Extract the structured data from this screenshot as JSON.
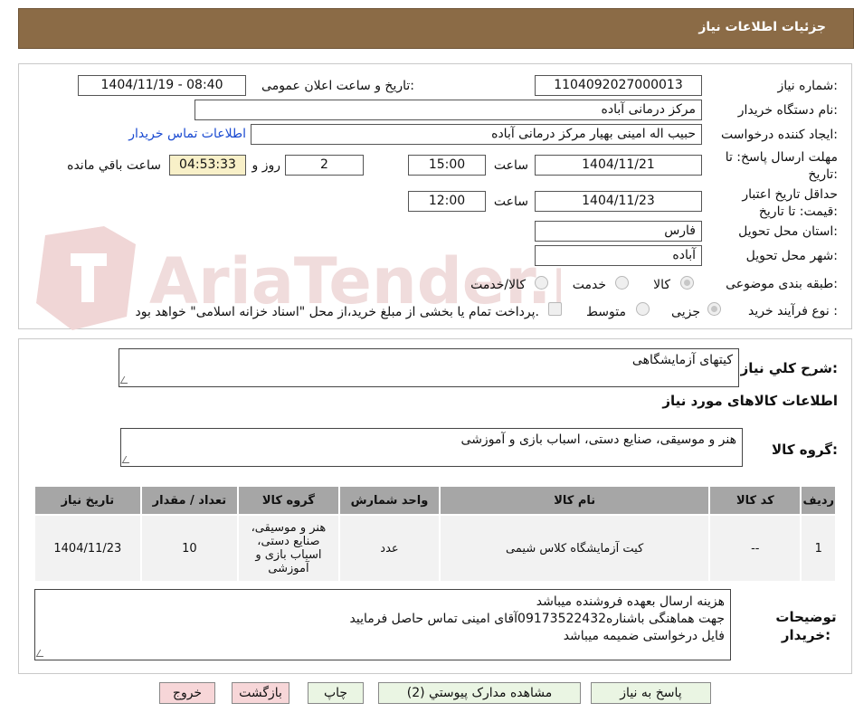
{
  "header": {
    "title": "جزئیات اطلاعات نیاز"
  },
  "form": {
    "need_number_label": "شماره نیاز:",
    "need_number": "1104092027000013",
    "announce_label": "تاریخ و ساعت اعلان عمومی:",
    "announce_value": "1404/11/19 - 08:40",
    "buyer_org_label": "نام دستگاه خریدار:",
    "buyer_org": "مرکز درمانی آباده",
    "creator_label": "ایجاد کننده درخواست:",
    "creator": "حبیب اله امینی بهیار مرکز درمانی آباده",
    "contact_link": "اطلاعات تماس خریدار",
    "deadline_label": "مهلت ارسال پاسخ: تا تاریخ:",
    "deadline_date": "1404/11/21",
    "time_label": "ساعت",
    "deadline_time": "15:00",
    "days_value": "2",
    "days_label": "روز و",
    "remaining_time": "04:53:33",
    "remaining_label": "ساعت باقي مانده",
    "validity_label": "حداقل تاریخ اعتبار قیمت: تا تاریخ:",
    "validity_date": "1404/11/23",
    "validity_time": "12:00",
    "province_label": "استان محل تحویل:",
    "province": "فارس",
    "city_label": "شهر محل تحویل:",
    "city": "آباده",
    "category_label": "طبقه بندی موضوعی:",
    "category_options": [
      "کالا",
      "خدمت",
      "کالا/خدمت"
    ],
    "process_label": "نوع فرآیند خرید :",
    "process_options": [
      "جزیی",
      "متوسط"
    ],
    "payment_note": "پرداخت تمام یا بخشی از مبلغ خرید،از محل \"اسناد خزانه اسلامی\" خواهد بود."
  },
  "watermark": {
    "text": "AriaTender.neT"
  },
  "details": {
    "summary_label": "شرح کلي نیاز:",
    "summary_value": "کیتهای آزمایشگاهی",
    "goods_section_title": "اطلاعات کالاهای مورد نیاز",
    "goods_group_label": "گروه کالا:",
    "goods_group_value": "هنر و موسیقی، صنایع دستی، اسباب بازی و آموزشی",
    "table": {
      "headers": [
        "ردیف",
        "کد کالا",
        "نام کالا",
        "واحد شمارش",
        "گروه کالا",
        "تعداد / مقدار",
        "تاریخ نیاز"
      ],
      "rows": [
        [
          "1",
          "--",
          "کیت آزمایشگاه کلاس شیمی",
          "عدد",
          "هنر و موسیقی، صنایع دستی، اسباب بازی و آموزشی",
          "10",
          "1404/11/23"
        ]
      ]
    },
    "buyer_notes_label": "توضیحات خریدار:",
    "buyer_notes": [
      "هزینه ارسال بعهده فروشنده میباشد",
      "جهت هماهنگی باشناره09173522432آقای امینی تماس حاصل فرمایید",
      "فایل درخواستی ضمیمه میباشد"
    ]
  },
  "buttons": {
    "reply": "پاسخ به نیاز",
    "attachments": "مشاهده مدارک پیوستي (2)",
    "print": "چاپ",
    "back": "بازگشت",
    "exit": "خروج"
  }
}
